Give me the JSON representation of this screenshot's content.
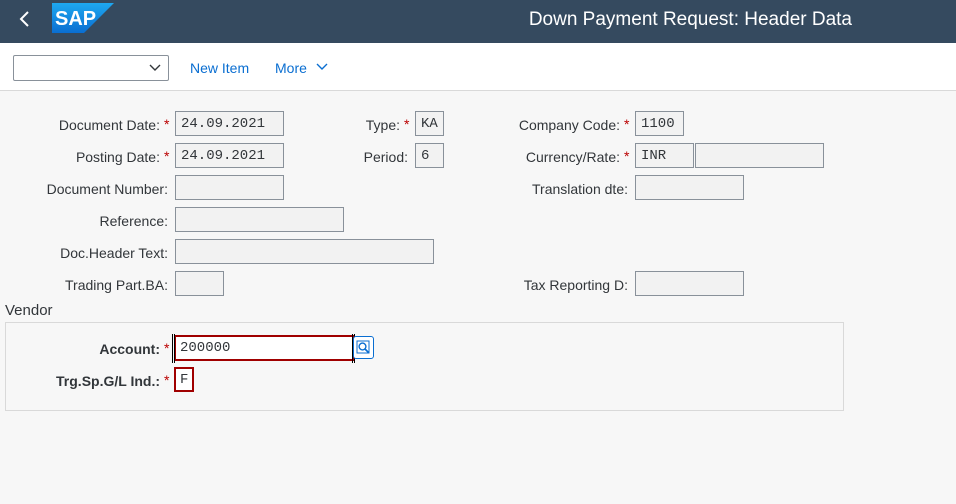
{
  "shell": {
    "title": "Down Payment Request: Header Data",
    "logo_text": "SAP",
    "back_icon": "chevron-left-icon"
  },
  "toolbar": {
    "select_value": "",
    "new_item_label": "New Item",
    "more_label": "More"
  },
  "header_fields": {
    "document_date": {
      "label": "Document Date:",
      "value": "24.09.2021",
      "required": true
    },
    "posting_date": {
      "label": "Posting Date:",
      "value": "24.09.2021",
      "required": true
    },
    "document_number": {
      "label": "Document Number:",
      "value": ""
    },
    "reference": {
      "label": "Reference:",
      "value": ""
    },
    "doc_header_text": {
      "label": "Doc.Header Text:",
      "value": ""
    },
    "trading_part": {
      "label": "Trading Part.BA:",
      "value": ""
    },
    "type": {
      "label": "Type:",
      "value": "KA",
      "required": true
    },
    "period": {
      "label": "Period:",
      "value": "6"
    },
    "company_code": {
      "label": "Company Code:",
      "value": "1100",
      "required": true
    },
    "currency_rate": {
      "label": "Currency/Rate:",
      "currency": "INR",
      "rate": "",
      "required": true
    },
    "translation_date": {
      "label": "Translation dte:",
      "value": ""
    },
    "tax_reporting": {
      "label": "Tax Reporting D:",
      "value": ""
    }
  },
  "vendor": {
    "section_title": "Vendor",
    "account": {
      "label": "Account:",
      "value": "200000",
      "required": true
    },
    "trg_sp_gl": {
      "label": "Trg.Sp.G/L Ind.:",
      "value": "F",
      "required": true
    }
  },
  "colors": {
    "shell_bg": "#354a5f",
    "link": "#0a6ed1",
    "required": "#bb0000",
    "active_border": "#a00000"
  }
}
